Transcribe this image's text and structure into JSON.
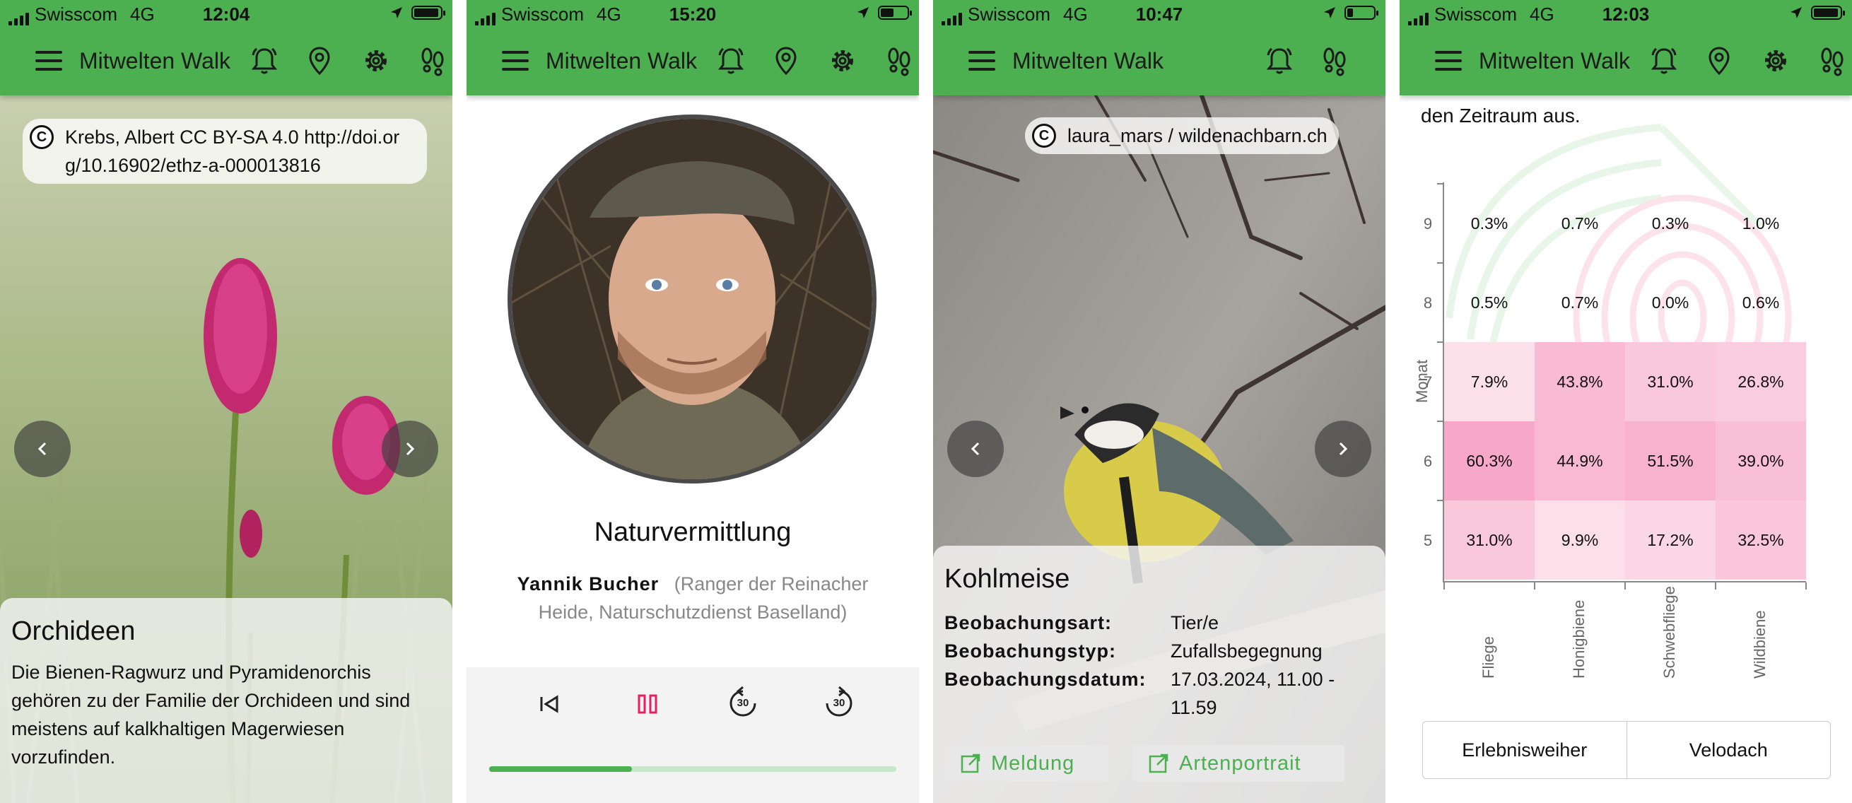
{
  "phones": [
    {
      "status": {
        "carrier": "Swisscom",
        "network": "4G",
        "time": "12:04"
      },
      "app_title": "Mitwelten Walk",
      "credit": {
        "cc_symbol": "C",
        "text": "Krebs, Albert CC BY-SA 4.0 http://doi.org/10.16902/ethz-a-000013816"
      },
      "info": {
        "title": "Orchideen",
        "text": "Die Bienen-Ragwurz und Pyramidenorchis gehören zu der Familie der Orchideen und sind meistens auf kalkhaltigen Magerwiesen vorzufinden."
      },
      "icons": [
        "menu-icon",
        "bell-icon",
        "location-pin-icon",
        "gear-icon",
        "footprints-icon",
        "chevron-left-icon",
        "chevron-right-icon"
      ]
    },
    {
      "status": {
        "carrier": "Swisscom",
        "network": "4G",
        "time": "15:20"
      },
      "app_title": "Mitwelten Walk",
      "section_title": "Naturvermittlung",
      "speaker": {
        "name": "Yannik Bucher",
        "role": "(Ranger der Reinacher Heide, Naturschutzdienst Baselland)"
      },
      "player": {
        "skip_back_label": "30",
        "skip_forward_label": "30",
        "progress": 0.35
      },
      "icons": [
        "menu-icon",
        "bell-icon",
        "location-pin-icon",
        "gear-icon",
        "footprints-icon",
        "skip-previous-icon",
        "pause-icon",
        "replay-30-icon",
        "forward-30-icon"
      ]
    },
    {
      "status": {
        "carrier": "Swisscom",
        "network": "4G",
        "time": "10:47"
      },
      "app_title": "Mitwelten Walk",
      "credit": {
        "cc_symbol": "C",
        "text": "laura_mars / wildenachbarn.ch"
      },
      "info": {
        "title": "Kohlmeise",
        "rows": [
          {
            "label": "Beobachungsart:",
            "value": "Tier/e"
          },
          {
            "label": "Beobachungstyp:",
            "value": "Zufallsbegegnung"
          },
          {
            "label": "Beobachungsdatum:",
            "value": "17.03.2024, 11.00 - 11.59"
          }
        ]
      },
      "buttons": {
        "report": "Meldung",
        "portrait": "Artenportrait"
      },
      "icons": [
        "menu-icon",
        "bell-icon",
        "footprints-icon",
        "chevron-left-icon",
        "chevron-right-icon",
        "open-external-icon"
      ]
    },
    {
      "status": {
        "carrier": "Swisscom",
        "network": "4G",
        "time": "12:03"
      },
      "app_title": "Mitwelten Walk",
      "intro_tail": "den Zeitraum aus.",
      "tabs": [
        "Erlebnisweiher",
        "Velodach"
      ],
      "icons": [
        "menu-icon",
        "bell-icon",
        "location-pin-icon",
        "gear-icon",
        "footprints-icon"
      ]
    }
  ],
  "colors": {
    "brand_green": "#4caf50",
    "accent_pink": "#e91e63",
    "heat_low": "#fde7ef",
    "heat_high": "#f8a9c8"
  },
  "chart_data": {
    "type": "heatmap",
    "ylabel": "Monat",
    "xlabel": "",
    "x_categories": [
      "Fliege",
      "Honigbiene",
      "Schwebfliege",
      "Wildbiene"
    ],
    "y_categories": [
      "9",
      "8",
      "7",
      "6",
      "5"
    ],
    "values": [
      [
        "0.3%",
        "0.7%",
        "0.3%",
        "1.0%"
      ],
      [
        "0.5%",
        "0.7%",
        "0.0%",
        "0.6%"
      ],
      [
        "7.9%",
        "43.8%",
        "31.0%",
        "26.8%"
      ],
      [
        "60.3%",
        "44.9%",
        "51.5%",
        "39.0%"
      ],
      [
        "31.0%",
        "9.9%",
        "17.2%",
        "32.5%"
      ]
    ],
    "numeric_values": [
      [
        0.3,
        0.7,
        0.3,
        1.0
      ],
      [
        0.5,
        0.7,
        0.0,
        0.6
      ],
      [
        7.9,
        43.8,
        31.0,
        26.8
      ],
      [
        60.3,
        44.9,
        51.5,
        39.0
      ],
      [
        31.0,
        9.9,
        17.2,
        32.5
      ]
    ],
    "grid": false
  }
}
